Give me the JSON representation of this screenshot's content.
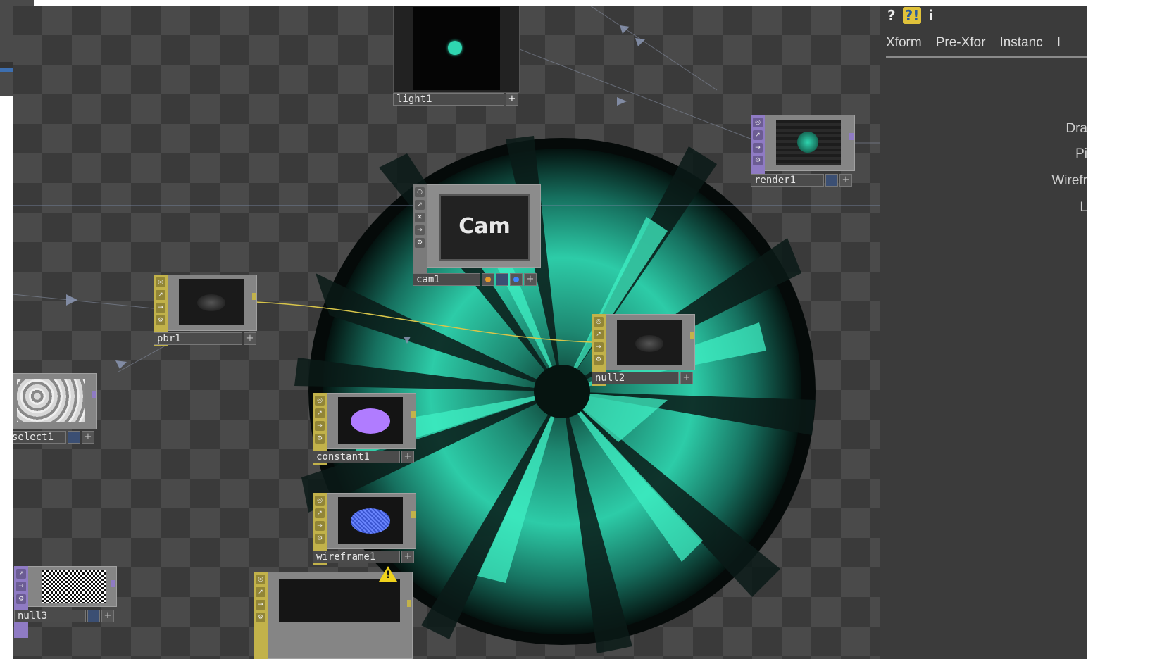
{
  "sidebar_left": {
    "value": "60"
  },
  "network": {
    "nodes": {
      "light1": {
        "label": "light1"
      },
      "render1": {
        "label": "render1"
      },
      "cam1": {
        "label": "cam1",
        "thumb_text": "Cam"
      },
      "pbr1": {
        "label": "pbr1"
      },
      "null2": {
        "label": "null2"
      },
      "select1": {
        "label": "select1"
      },
      "constant1": {
        "label": "constant1"
      },
      "wireframe1": {
        "label": "wireframe1"
      },
      "null3": {
        "label": "null3"
      }
    },
    "plus_glyph": "+"
  },
  "params": {
    "toolbar_icons": [
      "?",
      "?!",
      "i"
    ],
    "tabs": [
      "Xform",
      "Pre-Xfor",
      "Instanc",
      "I"
    ],
    "labels": [
      "Dra",
      "Pi",
      "Wirefr",
      "L"
    ]
  },
  "colors": {
    "accent_teal": "#2fd6b0",
    "material_node": "#c2b24a",
    "top_node": "#8f7bc4",
    "constant_color": "#b07cff",
    "wire_color": "#6b86ff"
  }
}
